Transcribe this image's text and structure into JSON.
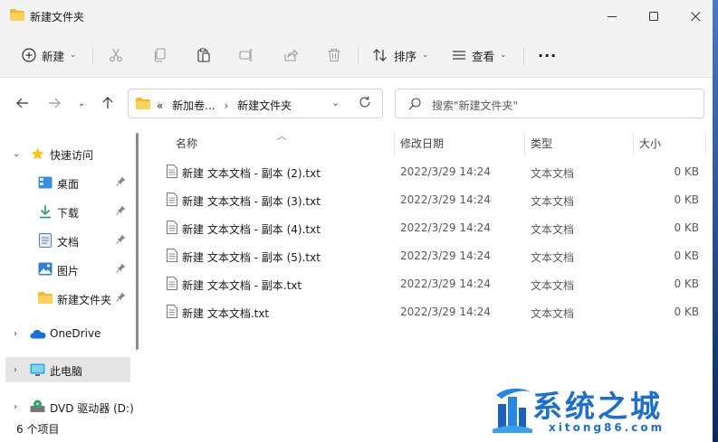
{
  "window": {
    "title": "新建文件夹"
  },
  "toolbar": {
    "new_label": "新建",
    "sort_label": "排序",
    "view_label": "查看",
    "more_label": "···"
  },
  "address": {
    "prefix": "«",
    "crumb1": "新加卷...",
    "separator": "›",
    "crumb2": "新建文件夹"
  },
  "search": {
    "placeholder": "搜索\"新建文件夹\""
  },
  "sidebar": {
    "items": [
      {
        "label": "快速访问",
        "icon": "star-icon"
      },
      {
        "label": "桌面",
        "icon": "desktop-icon"
      },
      {
        "label": "下载",
        "icon": "download-icon"
      },
      {
        "label": "文档",
        "icon": "document-icon"
      },
      {
        "label": "图片",
        "icon": "picture-icon"
      },
      {
        "label": "新建文件夹",
        "icon": "folder-icon"
      },
      {
        "label": "OneDrive",
        "icon": "cloud-icon"
      },
      {
        "label": "此电脑",
        "icon": "computer-icon"
      },
      {
        "label": "DVD 驱动器 (D:)",
        "icon": "dvd-icon"
      }
    ]
  },
  "columns": {
    "name": "名称",
    "date": "修改日期",
    "type": "类型",
    "size": "大小"
  },
  "files": [
    {
      "name": "新建 文本文档 - 副本 (2).txt",
      "date": "2022/3/29 14:24",
      "type": "文本文档",
      "size": "0 KB"
    },
    {
      "name": "新建 文本文档 - 副本 (3).txt",
      "date": "2022/3/29 14:24",
      "type": "文本文档",
      "size": "0 KB"
    },
    {
      "name": "新建 文本文档 - 副本 (4).txt",
      "date": "2022/3/29 14:24",
      "type": "文本文档",
      "size": "0 KB"
    },
    {
      "name": "新建 文本文档 - 副本 (5).txt",
      "date": "2022/3/29 14:24",
      "type": "文本文档",
      "size": "0 KB"
    },
    {
      "name": "新建 文本文档 - 副本.txt",
      "date": "2022/3/29 14:24",
      "type": "文本文档",
      "size": "0 KB"
    },
    {
      "name": "新建 文本文档.txt",
      "date": "2022/3/29 14:24",
      "type": "文本文档",
      "size": "0 KB"
    }
  ],
  "status": {
    "count": "6 个项目"
  },
  "watermark": {
    "title": "系统之城",
    "url": "xitong86.com"
  },
  "colors": {
    "folder": "#f2b632",
    "accent": "#1e6fc6",
    "selected": "#e5e5e5"
  }
}
